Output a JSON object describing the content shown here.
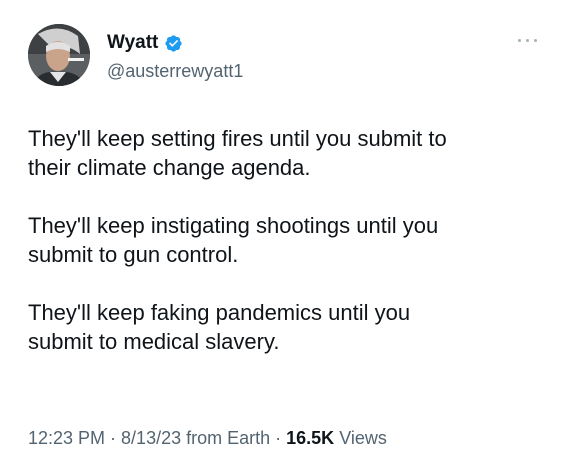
{
  "author": {
    "display_name": "Wyatt",
    "handle": "@austerrewyatt1",
    "verified": true,
    "avatar": "profile-photo"
  },
  "menu": {
    "icon": "more-options-icon"
  },
  "tweet": {
    "paragraphs": [
      "They'll keep setting fires until you submit to\ntheir climate change agenda.",
      "They'll keep instigating shootings until you\nsubmit to gun control.",
      "They'll keep faking pandemics until you\nsubmit to medical slavery."
    ]
  },
  "meta": {
    "time": "12:23 PM",
    "sep1": " · ",
    "date": "8/13/23",
    "source": " from Earth",
    "sep2": " · ",
    "views_count": "16.5K",
    "views_label": " Views"
  },
  "colors": {
    "verified": "#1d9bf0",
    "secondary_text": "#536471",
    "primary_text": "#0f1419"
  }
}
